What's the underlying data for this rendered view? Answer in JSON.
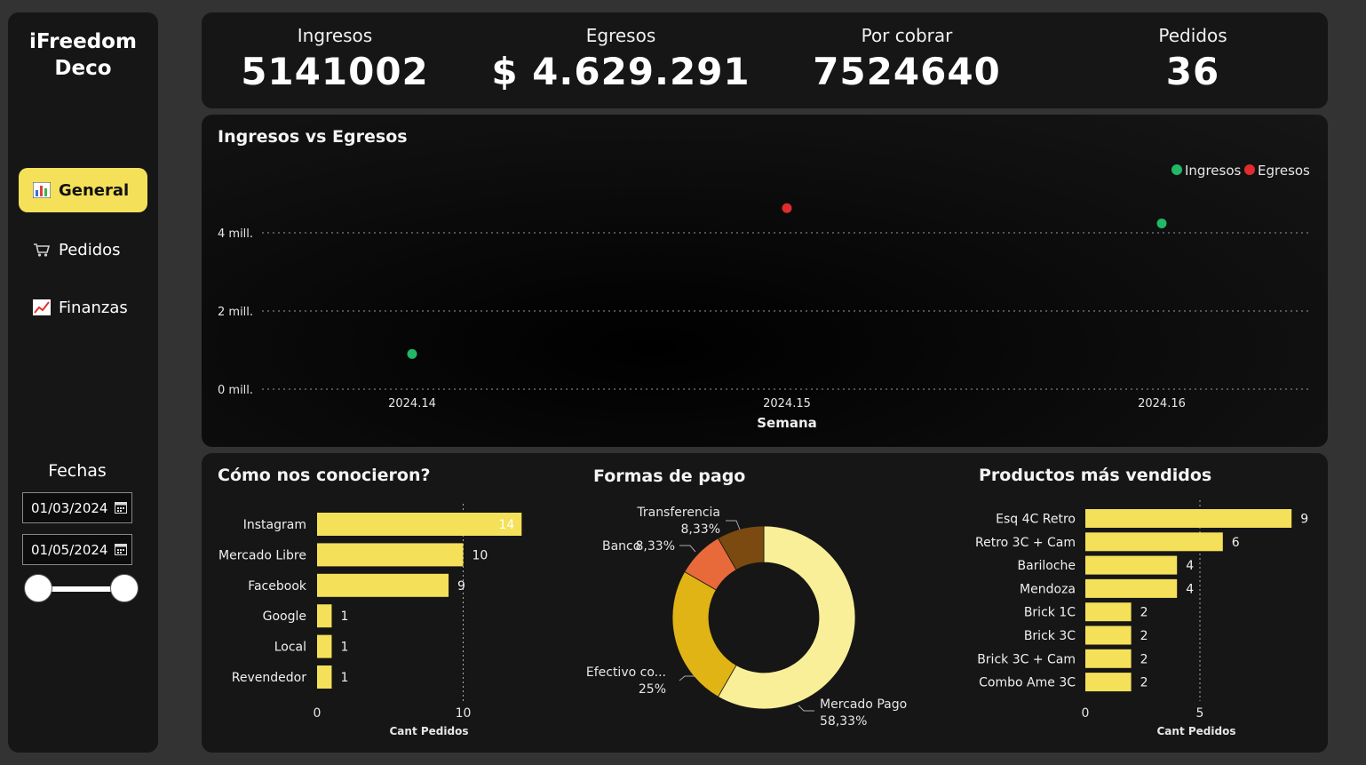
{
  "sidebar": {
    "brand_line1": "iFreedom",
    "brand_line2": "Deco",
    "nav": [
      {
        "label": "General",
        "icon": "bar-chart-icon",
        "active": true
      },
      {
        "label": "Pedidos",
        "icon": "shopping-cart-icon",
        "active": false
      },
      {
        "label": "Finanzas",
        "icon": "trend-chart-icon",
        "active": false
      }
    ],
    "fechas_title": "Fechas",
    "date_start": "01/03/2024",
    "date_end": "01/05/2024"
  },
  "kpis": [
    {
      "label": "Ingresos",
      "value": "5141002"
    },
    {
      "label": "Egresos",
      "value": "$ 4.629.291"
    },
    {
      "label": "Por cobrar",
      "value": "7524640"
    },
    {
      "label": "Pedidos",
      "value": "36"
    }
  ],
  "colors": {
    "accent": "#f5e05a",
    "ingresos": "#22b866",
    "egresos": "#e02c2c"
  },
  "chart_data": [
    {
      "type": "scatter",
      "title": "Ingresos vs Egresos",
      "xlabel": "Semana",
      "x": [
        "2024.14",
        "2024.15",
        "2024.16"
      ],
      "y_ticks": [
        "0 mill.",
        "2 mill.",
        "4 mill."
      ],
      "ylim": [
        0,
        4000000
      ],
      "legend_position": "top-right",
      "series": [
        {
          "name": "Ingresos",
          "points": [
            {
              "x": "2024.14",
              "y": 900000
            },
            {
              "x": "2024.16",
              "y": 4240000
            }
          ]
        },
        {
          "name": "Egresos",
          "points": [
            {
              "x": "2024.15",
              "y": 4630000
            }
          ]
        }
      ]
    },
    {
      "type": "bar",
      "title": "Cómo nos conocieron?",
      "xlabel": "Cant Pedidos",
      "categories": [
        "Instagram",
        "Mercado Libre",
        "Facebook",
        "Google",
        "Local",
        "Revendedor"
      ],
      "values": [
        14,
        10,
        9,
        1,
        1,
        1
      ],
      "x_ticks": [
        "0",
        "10"
      ],
      "xlim": [
        0,
        14
      ]
    },
    {
      "type": "pie",
      "title": "Formas de pago",
      "slices": [
        {
          "label": "Mercado Pago",
          "pct_label": "58,33%",
          "value": 58.33,
          "color": "#f8ef98"
        },
        {
          "label": "Efectivo co...",
          "pct_label": "25%",
          "value": 25,
          "color": "#e0b414"
        },
        {
          "label": "Banco",
          "pct_label": "8,33%",
          "value": 8.33,
          "color": "#e8693a"
        },
        {
          "label": "Transferencia",
          "pct_label": "8,33%",
          "value": 8.33,
          "color": "#7a4a10"
        }
      ]
    },
    {
      "type": "bar",
      "title": "Productos más vendidos",
      "xlabel": "Cant Pedidos",
      "categories": [
        "Esq 4C Retro",
        "Retro 3C + Cam",
        "Bariloche",
        "Mendoza",
        "Brick 1C",
        "Brick 3C",
        "Brick 3C + Cam",
        "Combo Ame 3C"
      ],
      "values": [
        9,
        6,
        4,
        4,
        2,
        2,
        2,
        2
      ],
      "x_ticks": [
        "0",
        "5"
      ],
      "xlim": [
        0,
        9
      ]
    }
  ]
}
